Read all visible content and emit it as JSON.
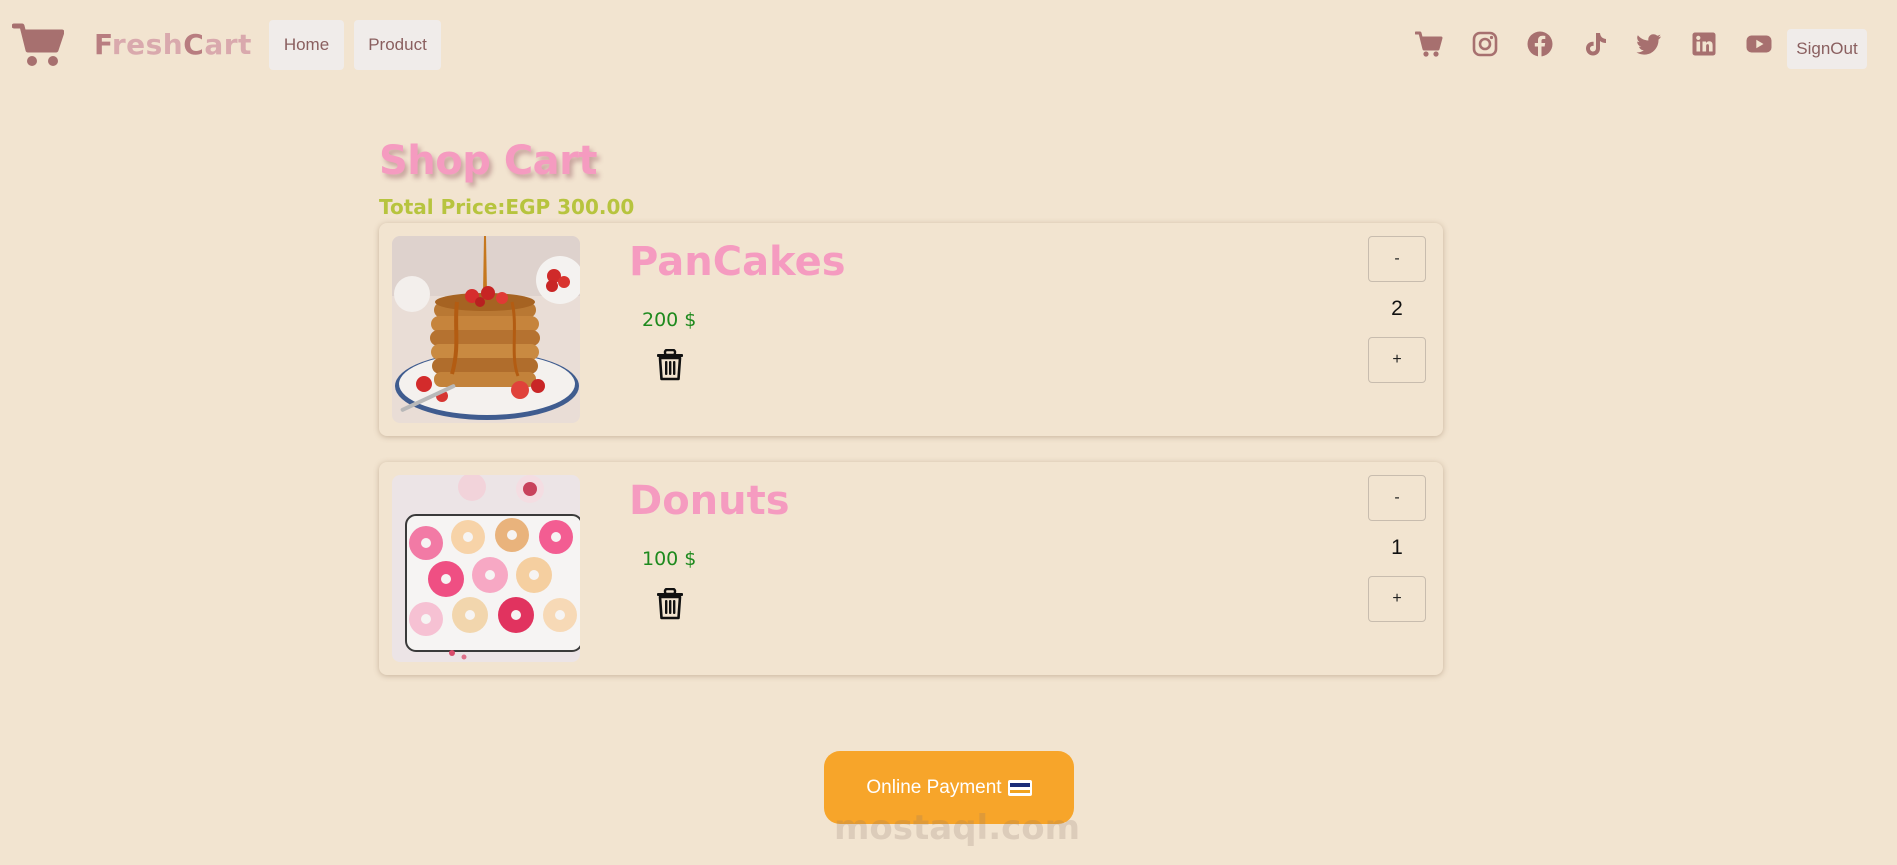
{
  "brand": {
    "first_letter": "F",
    "part1": "resh",
    "second_cap": "C",
    "part2": "art"
  },
  "nav": {
    "home": "Home",
    "product": "Product"
  },
  "social_icons": [
    "cart-icon",
    "instagram-icon",
    "facebook-icon",
    "tiktok-icon",
    "twitter-icon",
    "linkedin-icon",
    "youtube-icon"
  ],
  "signout": "SignOut",
  "page": {
    "title": "Shop Cart",
    "total_label": "Total Price:",
    "total_value": "EGP 300.00"
  },
  "cart": [
    {
      "name": "PanCakes",
      "price": "200 $",
      "quantity": "2",
      "minus": "-",
      "plus": "+"
    },
    {
      "name": "Donuts",
      "price": "100 $",
      "quantity": "1",
      "minus": "-",
      "plus": "+"
    }
  ],
  "payment": {
    "label": "Online Payment"
  },
  "watermark": "mostaql.com",
  "colors": {
    "background": "#f2e4d0",
    "accent_pink": "#f59bc0",
    "price_green": "#1e8a1e",
    "total_olive": "#b7c43e",
    "nav_icon": "#a7706f",
    "pay_button": "#f7a52a"
  }
}
